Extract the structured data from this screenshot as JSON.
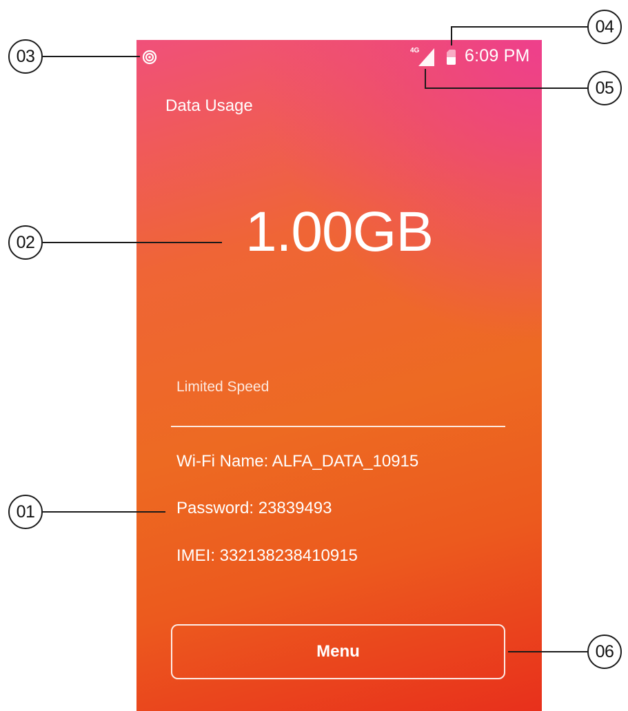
{
  "status_bar": {
    "network_type": "4G",
    "time": "6:09 PM",
    "icons": [
      "hotspot-icon",
      "signal-icon",
      "sim-card-icon"
    ]
  },
  "screen": {
    "title": "Data Usage",
    "usage_value": "1.00GB",
    "speed_status": "Limited Speed",
    "wifi_name": "Wi-Fi Name: ALFA_DATA_10915",
    "password": "Password: 23839493",
    "imei": "IMEI: 332138238410915",
    "menu_label": "Menu"
  },
  "callouts": {
    "c01": "01",
    "c02": "02",
    "c03": "03",
    "c04": "04",
    "c05": "05",
    "c06": "06"
  },
  "colors": {
    "gradient_top": "#f0507a",
    "gradient_mid": "#ed6a22",
    "gradient_bottom": "#e8301c",
    "accent_pink": "#ee3f8c"
  }
}
